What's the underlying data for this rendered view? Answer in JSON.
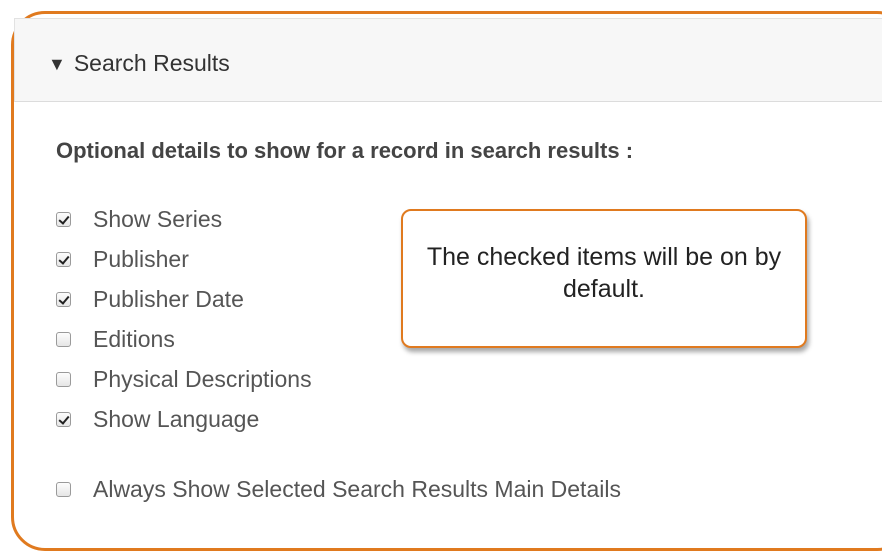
{
  "panel": {
    "caret": "▼",
    "title": "Search Results"
  },
  "section_heading": "Optional details to show for a record in search results :",
  "options": [
    {
      "label": "Show Series",
      "checked": true
    },
    {
      "label": "Publisher",
      "checked": true
    },
    {
      "label": "Publisher Date",
      "checked": true
    },
    {
      "label": "Editions",
      "checked": false
    },
    {
      "label": "Physical Descriptions",
      "checked": false
    },
    {
      "label": "Show Language",
      "checked": true
    }
  ],
  "always_show": {
    "label": "Always Show Selected Search Results Main Details",
    "checked": false
  },
  "callout": {
    "text": "The checked items will be on by default."
  },
  "colors": {
    "accent": "#e07a1f",
    "header_bg": "#f7f7f7",
    "text": "#555555"
  }
}
